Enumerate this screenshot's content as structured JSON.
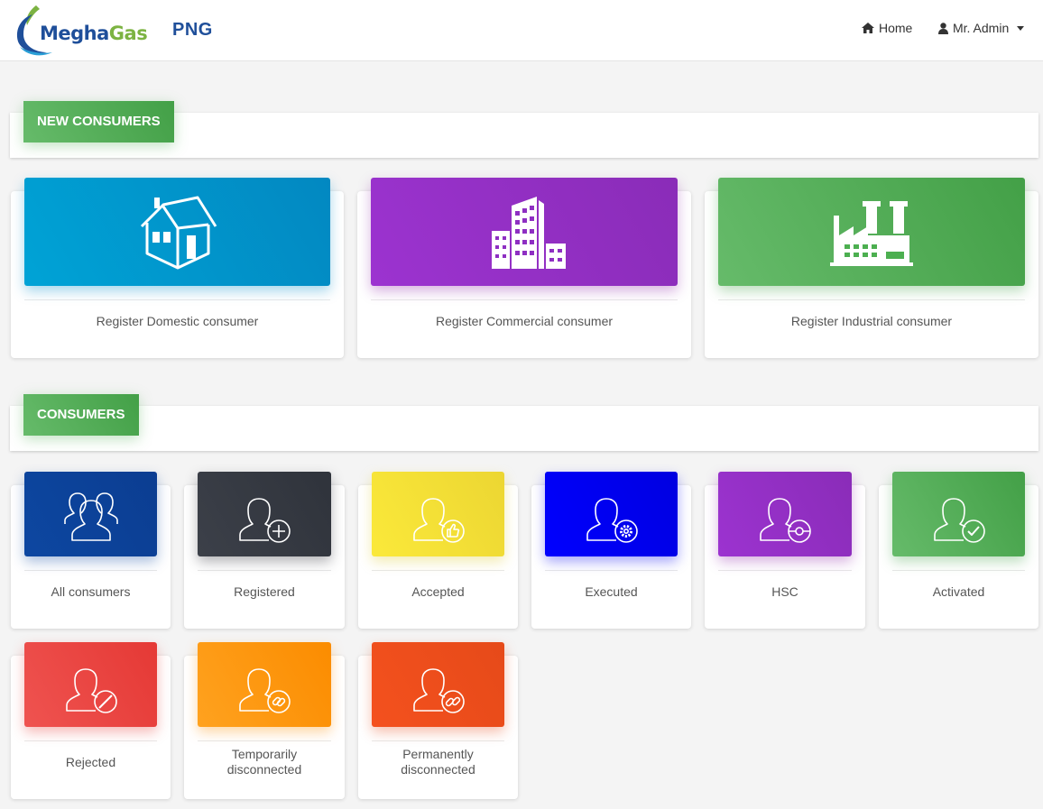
{
  "header": {
    "logo_first": "Megha",
    "logo_second": "Gas",
    "brand": "PNG",
    "home_label": "Home",
    "admin_label": "Mr. Admin"
  },
  "sections": {
    "new_consumers": "NEW CONSUMERS",
    "consumers": "CONSUMERS"
  },
  "new_consumer_cards": [
    {
      "label": "Register Domestic consumer",
      "icon": "house-icon",
      "color": "#0096c7"
    },
    {
      "label": "Register Commercial consumer",
      "icon": "building-icon",
      "color": "#8e2fc2"
    },
    {
      "label": "Register Industrial consumer",
      "icon": "factory-icon",
      "color": "#4caf50"
    }
  ],
  "consumer_cards": [
    {
      "label": "All consumers",
      "icon": "users-group-icon",
      "color": "#0d47a1"
    },
    {
      "label": "Registered",
      "icon": "user-add-icon",
      "color": "#343a44"
    },
    {
      "label": "Accepted",
      "icon": "user-thumbs-up-icon",
      "color": "#f5e137"
    },
    {
      "label": "Executed",
      "icon": "user-gear-icon",
      "color": "#0000f0"
    },
    {
      "label": "HSC",
      "icon": "user-meter-icon",
      "color": "#8e2fc2"
    },
    {
      "label": "Activated",
      "icon": "user-check-icon",
      "color": "#4caf50"
    },
    {
      "label": "Rejected",
      "icon": "user-block-icon",
      "color": "#e53935"
    },
    {
      "label": "Temporarily disconnected",
      "icon": "user-link-icon",
      "color": "#fb8c00"
    },
    {
      "label": "Permanently disconnected",
      "icon": "user-broken-link-icon",
      "color": "#e64a19"
    }
  ]
}
